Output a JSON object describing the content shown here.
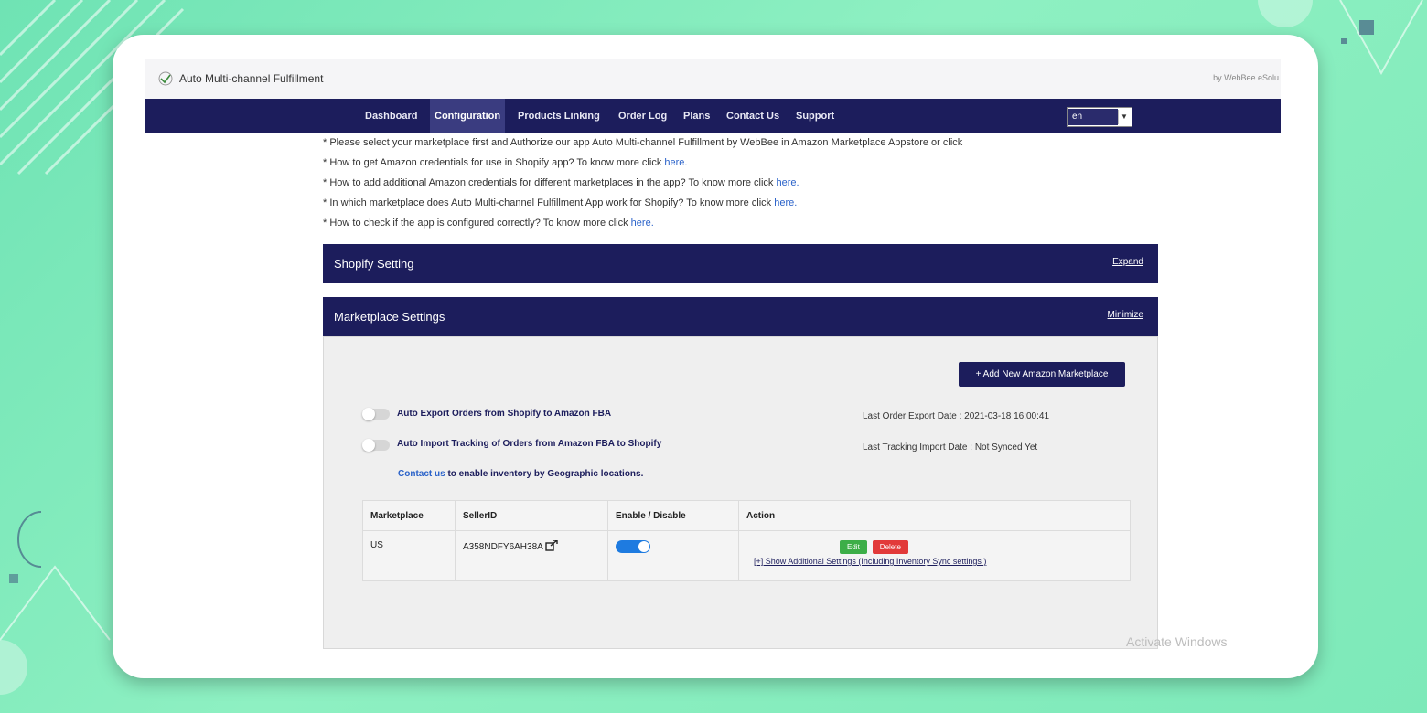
{
  "app": {
    "title": "Auto Multi-channel Fulfillment",
    "byline": "by WebBee eSolu"
  },
  "nav": {
    "items": [
      "Dashboard",
      "Configuration",
      "Products Linking",
      "Order Log",
      "Plans",
      "Contact Us",
      "Support"
    ],
    "active": "Configuration",
    "language": "en"
  },
  "info_lines": [
    {
      "text": "* Please select your marketplace first and Authorize our app Auto Multi-channel Fulfillment by WebBee in Amazon Marketplace Appstore or click",
      "link": ""
    },
    {
      "text": "* How to get Amazon credentials for use in Shopify app? To know more click ",
      "link": "here."
    },
    {
      "text": "* How to add additional Amazon credentials for different marketplaces in the app? To know more click ",
      "link": "here."
    },
    {
      "text": "* In which marketplace does Auto Multi-channel Fulfillment App work for Shopify? To know more click ",
      "link": "here."
    },
    {
      "text": "* How to check if the app is configured correctly? To know more click ",
      "link": "here."
    }
  ],
  "shopify_panel": {
    "title": "Shopify Setting",
    "link": "Expand"
  },
  "marketplace_panel": {
    "title": "Marketplace Settings",
    "link": "Minimize",
    "add_button": "+ Add New Amazon Marketplace",
    "toggles": [
      {
        "label": "Auto Export Orders from Shopify to Amazon FBA",
        "enabled": false
      },
      {
        "label": "Auto Import Tracking of Orders from Amazon FBA to Shopify",
        "enabled": false
      }
    ],
    "last_export": "Last Order Export Date : 2021-03-18 16:00:41",
    "last_tracking": "Last Tracking Import Date : Not Synced Yet",
    "contact_link": "Contact us",
    "contact_text": " to enable inventory by Geographic locations.",
    "table": {
      "headers": [
        "Marketplace",
        "SellerID",
        "Enable / Disable",
        "Action"
      ],
      "rows": [
        {
          "marketplace": "US",
          "seller_id": "A358NDFY6AH38A",
          "enabled": true,
          "edit": "Edit",
          "delete": "Delete",
          "additional": "[+] Show Additional Settings (Including Inventory Sync settings )"
        }
      ]
    }
  },
  "watermark": "Activate Windows",
  "colors": {
    "navy": "#1c1d5c",
    "link": "#2a62c9",
    "toggle_on": "#1e7be0",
    "edit": "#3cae48",
    "delete": "#e23a3a",
    "background": "#7de9b9"
  }
}
